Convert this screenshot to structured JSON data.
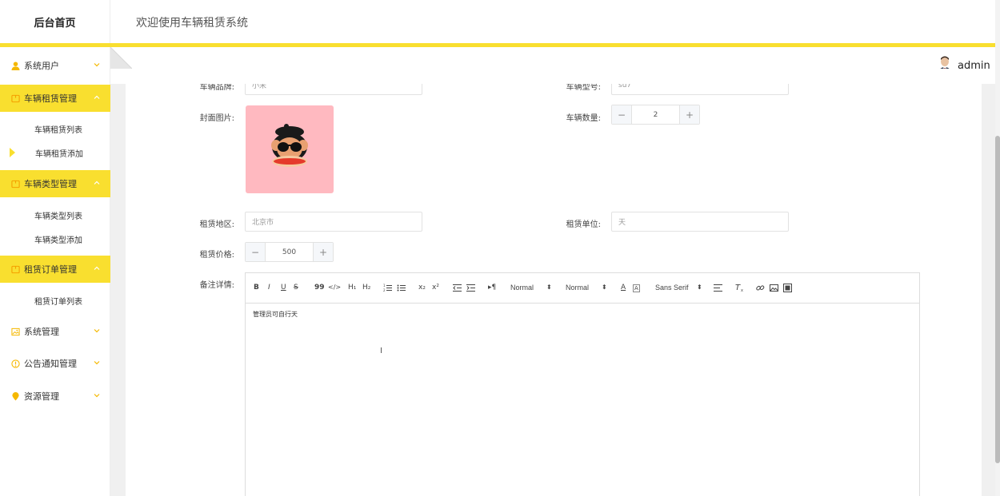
{
  "header": {
    "brand": "后台首页",
    "welcome": "欢迎使用车辆租赁系统",
    "user_name": "admin"
  },
  "sidebar": {
    "accent_color": "#f9df2f",
    "items": [
      {
        "label": "系统用户",
        "icon": "user-icon",
        "active": false,
        "expanded": false
      },
      {
        "label": "车辆租赁管理",
        "icon": "folder-icon",
        "active": true,
        "expanded": true,
        "children": [
          {
            "label": "车辆租赁列表",
            "current": false
          },
          {
            "label": "车辆租赁添加",
            "current": true
          }
        ]
      },
      {
        "label": "车辆类型管理",
        "icon": "folder-icon",
        "active": true,
        "expanded": true,
        "children": [
          {
            "label": "车辆类型列表",
            "current": false
          },
          {
            "label": "车辆类型添加",
            "current": false
          }
        ]
      },
      {
        "label": "租赁订单管理",
        "icon": "folder-icon",
        "active": true,
        "expanded": true,
        "children": [
          {
            "label": "租赁订单列表",
            "current": false
          }
        ]
      },
      {
        "label": "系统管理",
        "icon": "image-icon",
        "active": false,
        "expanded": false
      },
      {
        "label": "公告通知管理",
        "icon": "info-circle-icon",
        "active": false,
        "expanded": false
      },
      {
        "label": "资源管理",
        "icon": "location-pin-icon",
        "active": false,
        "expanded": false
      }
    ]
  },
  "form": {
    "brand_label": "车辆品牌:",
    "brand_value": "小米",
    "model_label": "车辆型号:",
    "model_value": "su7",
    "cover_label": "封面图片:",
    "quantity_label": "车辆数量:",
    "quantity_value": "2",
    "region_label": "租赁地区:",
    "region_placeholder": "北京市",
    "unit_label": "租赁单位:",
    "unit_placeholder": "天",
    "price_label": "租赁价格:",
    "price_value": "500",
    "notes_label": "备注详情:",
    "stepper_minus": "−",
    "stepper_plus": "+"
  },
  "editor": {
    "toolbar": {
      "bold": "B",
      "italic": "I",
      "underline": "U",
      "strike": "S",
      "quote": "99",
      "code": "</>",
      "h1": "H₁",
      "h2": "H₂",
      "subscript": "x₂",
      "superscript": "x²",
      "text_direction": "▸¶",
      "header_select": "Normal",
      "size_select": "Normal",
      "font_select": "Sans Serif",
      "font_color": "A",
      "background_color": "A"
    },
    "content": "管理员可自行天"
  }
}
